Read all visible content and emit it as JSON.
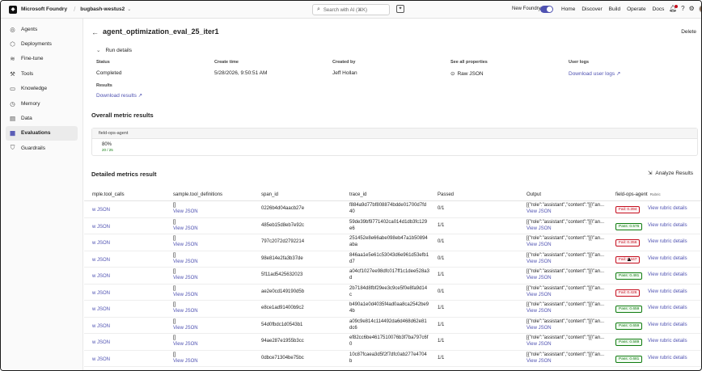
{
  "topbar": {
    "brand": "Microsoft Foundry",
    "project": "bugbash-westus2",
    "search_placeholder": "Search with AI (⌘K)",
    "new_foundry_label": "New Foundry",
    "nav": [
      "Home",
      "Discover",
      "Build",
      "Operate",
      "Docs"
    ]
  },
  "sidebar": {
    "items": [
      {
        "label": "Agents",
        "icon": "agents-icon",
        "glyph": "◎"
      },
      {
        "label": "Deployments",
        "icon": "deployments-icon",
        "glyph": "⬡"
      },
      {
        "label": "Fine-tune",
        "icon": "fine-tune-icon",
        "glyph": "≋"
      },
      {
        "label": "Tools",
        "icon": "tools-icon",
        "glyph": "⚒"
      },
      {
        "label": "Knowledge",
        "icon": "knowledge-icon",
        "glyph": "▭"
      },
      {
        "label": "Memory",
        "icon": "memory-icon",
        "glyph": "◷"
      },
      {
        "label": "Data",
        "icon": "data-icon",
        "glyph": "▤"
      },
      {
        "label": "Evaluations",
        "icon": "evaluations-icon",
        "glyph": "▦",
        "active": true
      },
      {
        "label": "Guardrails",
        "icon": "guardrails-icon",
        "glyph": "⛉"
      }
    ]
  },
  "page": {
    "title": "agent_optimization_eval_25_iter1",
    "delete_label": "Delete",
    "run_details_label": "Run details"
  },
  "run_details": {
    "status_label": "Status",
    "status_value": "Completed",
    "created_time_label": "Create time",
    "created_time_value": "5/28/2026, 9:50:51 AM",
    "created_by_label": "Created by",
    "created_by_value": "Jeff Hollan",
    "properties_label": "See all properties",
    "properties_value": "Raw JSON",
    "user_logs_label": "User logs",
    "user_logs_value": "Download user logs",
    "results_label": "Results",
    "results_value": "Download results"
  },
  "overall": {
    "section_title": "Overall metric results",
    "card_header": "field-ops-agent",
    "percent": "80%",
    "fraction": "20 / 25"
  },
  "detailed": {
    "section_title": "Detailed metrics result",
    "analyze_label": "Analyze Results",
    "columns": [
      "mple.tool_calls",
      "sample.tool_definitions",
      "span_id",
      "trace_id",
      "Passed",
      "Output",
      "field-ops-agent"
    ],
    "column_sub": "Rubric",
    "view_json": "View JSON",
    "view_json_truncated": "w JSON",
    "view_rubric": "View rubric details",
    "rows": [
      {
        "defs": "[]",
        "span": "0226b4d04aacb27e",
        "trace1": "f884a9d77bf808874bdde01700d7fd",
        "trace2": "40",
        "passed": "0/1",
        "output": "[{\"role\":\"assistant\",\"content\":\"[{\\\"an...",
        "status": "fail",
        "score": "Fail: 0.394"
      },
      {
        "defs": "[]",
        "span": "485eb15d8eb7e92c",
        "trace1": "59de39bf9771402ca014d1db3fc129",
        "trace2": "e6",
        "passed": "1/1",
        "output": "[{\"role\":\"assistant\",\"content\":\"[{\\\"an...",
        "status": "pass",
        "score": "Pass: 0.576"
      },
      {
        "defs": "[]",
        "span": "797c2072d2792214",
        "trace1": "251452e8e66abe098eb47a1b50894",
        "trace2": "aba",
        "passed": "0/1",
        "output": "[{\"role\":\"assistant\",\"content\":\"[{\\\"an...",
        "status": "fail",
        "score": "Fail: 0.356"
      },
      {
        "defs": "[]",
        "span": "98e814e2fa3b37de",
        "trace1": "846aa1e5e61c53043d6e961d53efb1",
        "trace2": "d7",
        "passed": "0/1",
        "output": "[{\"role\":\"assistant\",\"content\":\"[{\\\"an...",
        "status": "fail",
        "score": "Fail: 0.447"
      },
      {
        "defs": "[]",
        "span": "5f11ad5425632023",
        "trace1": "a04cf1027ee98dfc017ff1c1dee528a3",
        "trace2": "d",
        "passed": "1/1",
        "output": "[{\"role\":\"assistant\",\"content\":\"[{\\\"an...",
        "status": "pass",
        "score": "Pass: 0.481"
      },
      {
        "defs": "[]",
        "span": "ae2e0cd149190d5b",
        "trace1": "2b7184d8fbf29ee3c9ce5f0e8fa9d14",
        "trace2": "c",
        "passed": "0/1",
        "output": "[{\"role\":\"assistant\",\"content\":\"[{\\\"an...",
        "status": "fail",
        "score": "Fail: 0.426"
      },
      {
        "defs": "[]",
        "span": "e8ce1ad91400b9c2",
        "trace1": "b490a1e0d4035f4ad0aa8ca2542be9",
        "trace2": "4b",
        "passed": "1/1",
        "output": "[{\"role\":\"assistant\",\"content\":\"[{\\\"an...",
        "status": "pass",
        "score": "Pass: 0.659"
      },
      {
        "defs": "[]",
        "span": "54d0fbdc1d0543b1",
        "trace1": "a09c9e814c114492da6d468d62e81",
        "trace2": "dc6",
        "passed": "1/1",
        "output": "[{\"role\":\"assistant\",\"content\":\"[{\\\"an...",
        "status": "pass",
        "score": "Pass: 0.659"
      },
      {
        "defs": "[]",
        "span": "94ae287e1955b3cc",
        "trace1": "ef82cc6be4617510076b3f7ba797c6f",
        "trace2": "0",
        "passed": "1/1",
        "output": "[{\"role\":\"assistant\",\"content\":\"[{\\\"an...",
        "status": "pass",
        "score": "Pass: 0.589"
      },
      {
        "defs": "[]",
        "span": "0dbce71304be75bc",
        "trace1": "10c87fcaea3d5f2f7dfc0ab277e4704",
        "trace2": "b",
        "passed": "1/1",
        "output": "[{\"role\":\"assistant\",\"content\":\"[{\\\"an...",
        "status": "pass",
        "score": "Pass: 0.681"
      }
    ]
  },
  "colors": {
    "accent": "#4f52b2",
    "pass": "#107c10",
    "fail": "#c50f1f"
  }
}
